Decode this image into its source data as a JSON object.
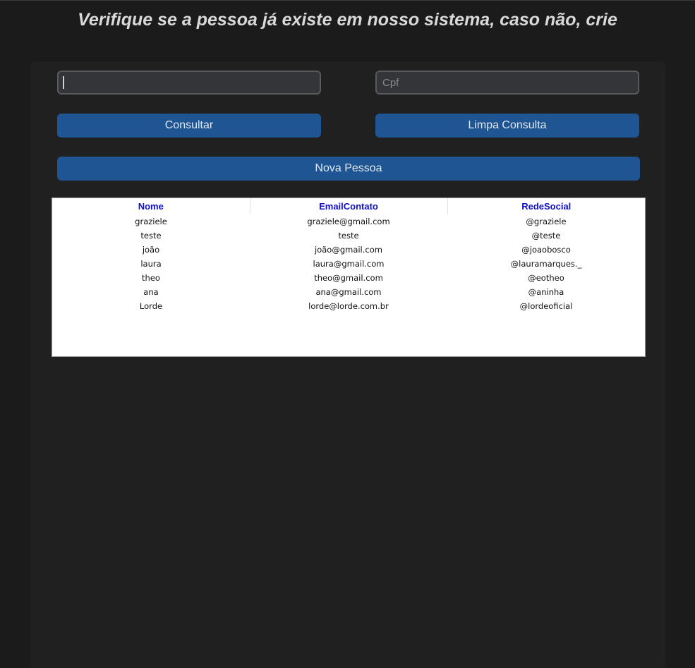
{
  "page": {
    "title": "Verifique se a pessoa já existe em nosso sistema, caso não, crie"
  },
  "form": {
    "name_value": "",
    "cpf_placeholder": "Cpf",
    "consultar_label": "Consultar",
    "limpa_label": "Limpa Consulta",
    "nova_label": "Nova Pessoa"
  },
  "table": {
    "headers": [
      "Nome",
      "EmailContato",
      "RedeSocial"
    ],
    "rows": [
      [
        "graziele",
        "graziele@gmail.com",
        "@graziele"
      ],
      [
        "teste",
        "teste",
        "@teste"
      ],
      [
        "joão",
        "joão@gmail.com",
        "@joaobosco"
      ],
      [
        "laura",
        "laura@gmail.com",
        "@lauramarques._"
      ],
      [
        "theo",
        "theo@gmail.com",
        "@eotheo"
      ],
      [
        "ana",
        "ana@gmail.com",
        "@aninha"
      ],
      [
        "Lorde",
        "lorde@lorde.com.br",
        "@lordeoficial"
      ]
    ]
  },
  "colors": {
    "background": "#1b1b1b",
    "panel": "#202020",
    "button": "#1f5592",
    "header_text": "#1010c8"
  }
}
